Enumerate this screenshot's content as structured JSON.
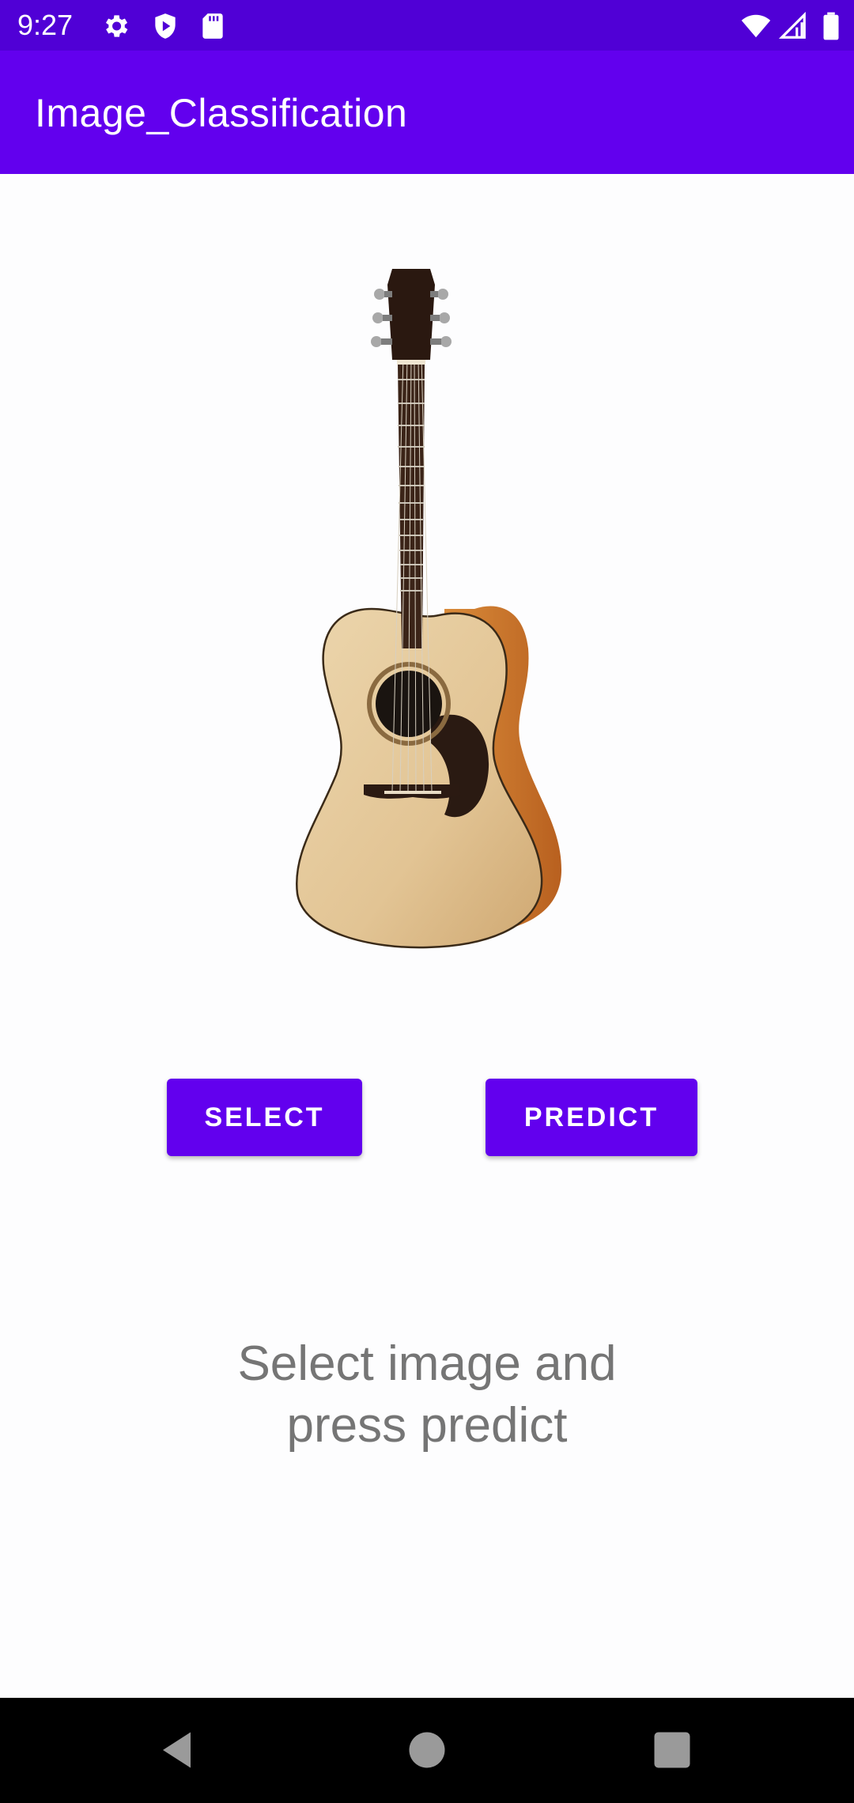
{
  "status_bar": {
    "time": "9:27",
    "icons_left": [
      "gear-icon",
      "shield-play-icon",
      "sd-card-icon"
    ],
    "icons_right": [
      "wifi-icon",
      "signal-icon",
      "battery-icon"
    ]
  },
  "app_bar": {
    "title": "Image_Classification",
    "color": "#6200ee"
  },
  "main": {
    "image": "guitar-image",
    "select_label": "SELECT",
    "predict_label": "PREDICT",
    "result_line1": "Select image and",
    "result_line2": "press predict"
  },
  "nav_bar": {
    "buttons": [
      "back-icon",
      "home-icon",
      "recents-icon"
    ]
  }
}
